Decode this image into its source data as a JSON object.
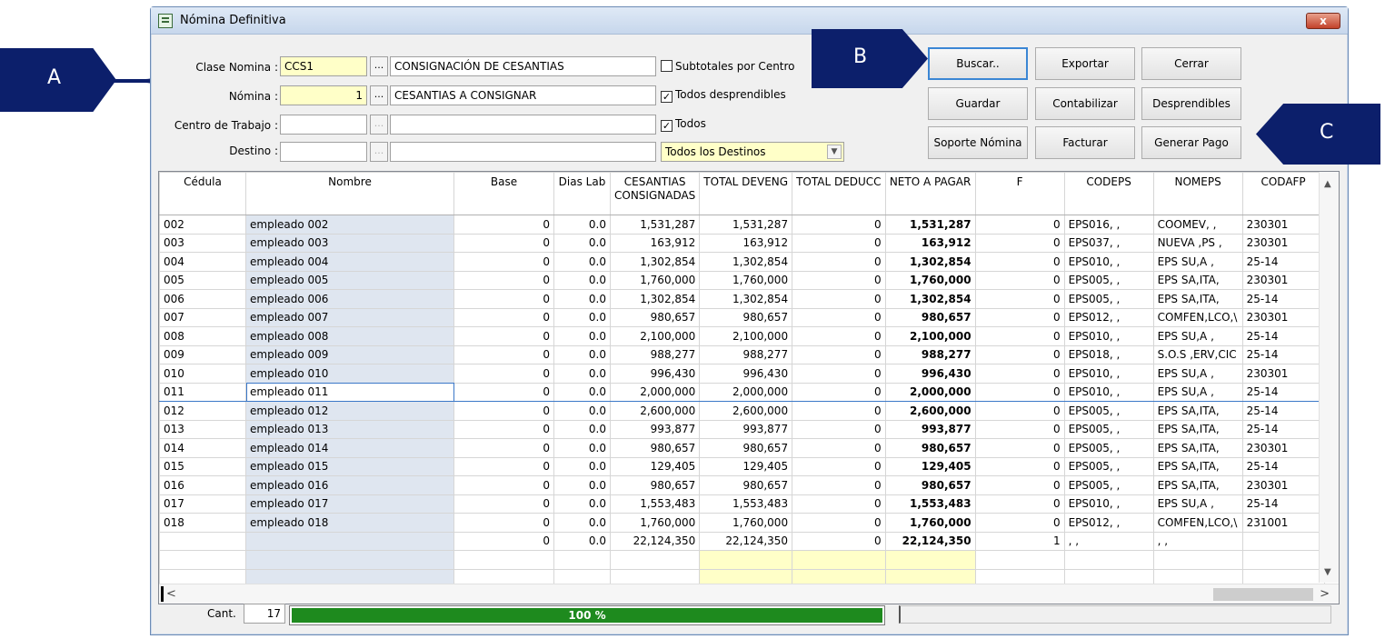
{
  "window": {
    "title": "Nómina Definitiva",
    "close_label": "x"
  },
  "filters": {
    "clase_nomina": {
      "label": "Clase Nomina :",
      "code": "CCS1",
      "desc": "CONSIGNACIÓN DE CESANTIAS"
    },
    "nomina": {
      "label": "Nómina :",
      "code": "1",
      "desc": "CESANTIAS A CONSIGNAR"
    },
    "centro": {
      "label": "Centro de Trabajo :",
      "code": "",
      "desc": ""
    },
    "destino": {
      "label": "Destino :",
      "code": "",
      "desc": "",
      "select": "Todos los Destinos"
    },
    "lookup_label": "...",
    "check_subtotales": {
      "label": "Subtotales por Centro",
      "checked": false
    },
    "check_desprendibles": {
      "label": "Todos desprendibles",
      "checked": true
    },
    "check_todos": {
      "label": "Todos",
      "checked": true
    }
  },
  "buttons": {
    "buscar": "Buscar..",
    "exportar": "Exportar",
    "cerrar": "Cerrar",
    "guardar": "Guardar",
    "contabilizar": "Contabilizar",
    "desprendibles": "Desprendibles",
    "soporte": "Soporte Nómina",
    "facturar": "Facturar",
    "generar_pago": "Generar Pago"
  },
  "callouts": {
    "a": "A",
    "b": "B",
    "c": "C"
  },
  "table": {
    "headers": [
      "Cédula",
      "Nombre",
      "Base",
      "Dias Lab",
      "CESANTIAS CONSIGNADAS",
      "TOTAL DEVENG",
      "TOTAL DEDUCC",
      "NETO A PAGAR",
      "F",
      "CODEPS",
      "NOMEPS",
      "CODAFP"
    ],
    "rows": [
      [
        "002",
        "empleado 002",
        "0",
        "0.0",
        "1,531,287",
        "1,531,287",
        "0",
        "1,531,287",
        "0",
        "EPS016,  ,",
        "COOMEV,  ,",
        "230301"
      ],
      [
        "003",
        "empleado 003",
        "0",
        "0.0",
        "163,912",
        "163,912",
        "0",
        "163,912",
        "0",
        "EPS037,  ,",
        "NUEVA ,PS ,",
        "230301"
      ],
      [
        "004",
        "empleado 004",
        "0",
        "0.0",
        "1,302,854",
        "1,302,854",
        "0",
        "1,302,854",
        "0",
        "EPS010,  ,",
        "EPS SU,A  ,",
        "25-14"
      ],
      [
        "005",
        "empleado 005",
        "0",
        "0.0",
        "1,760,000",
        "1,760,000",
        "0",
        "1,760,000",
        "0",
        "EPS005,  ,",
        "EPS SA,ITA,",
        "230301"
      ],
      [
        "006",
        "empleado 006",
        "0",
        "0.0",
        "1,302,854",
        "1,302,854",
        "0",
        "1,302,854",
        "0",
        "EPS005,  ,",
        "EPS SA,ITA,",
        "25-14"
      ],
      [
        "007",
        "empleado 007",
        "0",
        "0.0",
        "980,657",
        "980,657",
        "0",
        "980,657",
        "0",
        "EPS012,  ,",
        "COMFEN,LCO,\\",
        "230301"
      ],
      [
        "008",
        "empleado 008",
        "0",
        "0.0",
        "2,100,000",
        "2,100,000",
        "0",
        "2,100,000",
        "0",
        "EPS010,  ,",
        "EPS SU,A  ,",
        "25-14"
      ],
      [
        "009",
        "empleado 009",
        "0",
        "0.0",
        "988,277",
        "988,277",
        "0",
        "988,277",
        "0",
        "EPS018,  ,",
        "S.O.S ,ERV,CIC",
        "25-14"
      ],
      [
        "010",
        "empleado 010",
        "0",
        "0.0",
        "996,430",
        "996,430",
        "0",
        "996,430",
        "0",
        "EPS010,  ,",
        "EPS SU,A  ,",
        "230301"
      ],
      [
        "011",
        "empleado 011",
        "0",
        "0.0",
        "2,000,000",
        "2,000,000",
        "0",
        "2,000,000",
        "0",
        "EPS010,  ,",
        "EPS SU,A  ,",
        "25-14"
      ],
      [
        "012",
        "empleado 012",
        "0",
        "0.0",
        "2,600,000",
        "2,600,000",
        "0",
        "2,600,000",
        "0",
        "EPS005,  ,",
        "EPS SA,ITA,",
        "25-14"
      ],
      [
        "013",
        "empleado 013",
        "0",
        "0.0",
        "993,877",
        "993,877",
        "0",
        "993,877",
        "0",
        "EPS005,  ,",
        "EPS SA,ITA,",
        "25-14"
      ],
      [
        "014",
        "empleado 014",
        "0",
        "0.0",
        "980,657",
        "980,657",
        "0",
        "980,657",
        "0",
        "EPS005,  ,",
        "EPS SA,ITA,",
        "230301"
      ],
      [
        "015",
        "empleado 015",
        "0",
        "0.0",
        "129,405",
        "129,405",
        "0",
        "129,405",
        "0",
        "EPS005,  ,",
        "EPS SA,ITA,",
        "25-14"
      ],
      [
        "016",
        "empleado 016",
        "0",
        "0.0",
        "980,657",
        "980,657",
        "0",
        "980,657",
        "0",
        "EPS005,  ,",
        "EPS SA,ITA,",
        "230301"
      ],
      [
        "017",
        "empleado 017",
        "0",
        "0.0",
        "1,553,483",
        "1,553,483",
        "0",
        "1,553,483",
        "0",
        "EPS010,  ,",
        "EPS SU,A  ,",
        "25-14"
      ],
      [
        "018",
        "empleado 018",
        "0",
        "0.0",
        "1,760,000",
        "1,760,000",
        "0",
        "1,760,000",
        "0",
        "EPS012,  ,",
        "COMFEN,LCO,\\",
        "231001"
      ],
      [
        "",
        "",
        "0",
        "0.0",
        "22,124,350",
        "22,124,350",
        "0",
        "22,124,350",
        "1",
        "  ,  ,",
        "  ,  ,",
        ""
      ]
    ],
    "selected_row": 9
  },
  "footer": {
    "cant_label": "Cant.",
    "cant_value": "17",
    "progress_text": "100 %",
    "progress": 1.0
  },
  "colors": {
    "callout": "#0c1f6b",
    "progress": "#1e8a1e",
    "highlight": "#ffffc8"
  }
}
